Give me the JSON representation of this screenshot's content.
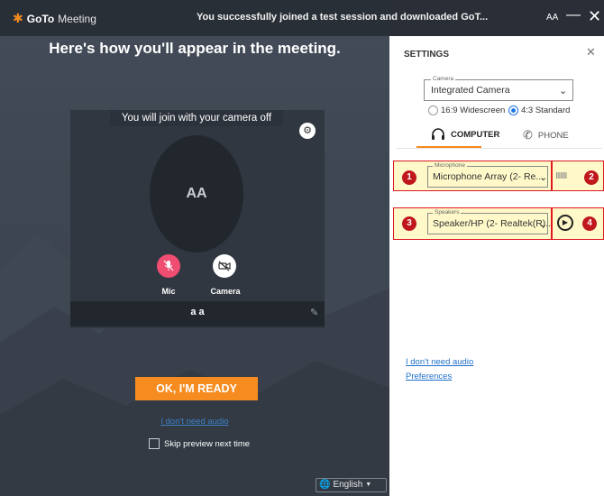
{
  "app": {
    "logo_goto": "GoTo",
    "logo_meeting": "Meeting",
    "notice": "You successfully joined a test session and downloaded GoT...",
    "initials": "AA",
    "minimize": "—",
    "close": "✕"
  },
  "preview": {
    "heading": "Here's how you'll appear in the meeting.",
    "camera_off_text": "You will join with your camera off",
    "avatar_initials": "AA",
    "mic_label": "Mic",
    "camera_label": "Camera",
    "display_name": "a a",
    "ok_button": "OK, I'M READY",
    "no_audio_link": "I don't need audio",
    "skip_preview": "Skip preview next time",
    "language": "English"
  },
  "settings": {
    "title": "SETTINGS",
    "camera_label": "Camera",
    "camera_value": "Integrated Camera",
    "ratio_widescreen": "16:9 Widescreen",
    "ratio_standard": "4:3 Standard",
    "tab_computer": "COMPUTER",
    "tab_phone": "PHONE",
    "mic_label": "Microphone",
    "mic_value": "Microphone Array (2- Re...",
    "speakers_label": "Speakers",
    "speakers_value": "Speaker/HP (2- Realtek(R)...",
    "meter": "IIIIIII",
    "no_audio_link": "I don't need audio",
    "preferences_link": "Preferences",
    "badges": [
      "1",
      "2",
      "3",
      "4"
    ],
    "colors": {
      "accent": "#f68b1f",
      "badge": "#c0171c",
      "highlight": "#fff9c9",
      "link": "#1f6fc9"
    }
  }
}
